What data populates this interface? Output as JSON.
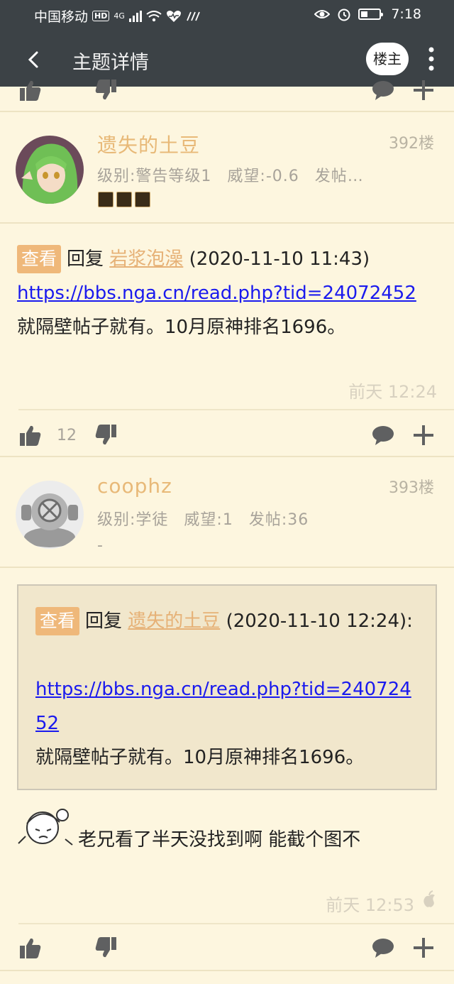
{
  "statusbar": {
    "carrier": "中国移动",
    "hd": "HD",
    "network": "4G",
    "time": "7:18"
  },
  "appbar": {
    "title": "主题详情",
    "louzhu_label": "楼主"
  },
  "posts": [
    {
      "username": "遗失的土豆",
      "floor": "392楼",
      "level": "级别:警告等级1",
      "prestige": "威望:-0.6",
      "posts": "发帖…",
      "reply_tag": "查看",
      "reply_word": "回复",
      "reply_to": "岩浆泡澡",
      "reply_time": "(2020-11-10 11:43)",
      "url": "https://bbs.nga.cn/read.php?tid=24072452",
      "text": "就隔壁帖子就有。10月原神排名1696。",
      "time": "前天 12:24",
      "like_count": "12"
    },
    {
      "username": "coophz",
      "floor": "393楼",
      "level": "级别:学徒",
      "prestige": "威望:1",
      "posts": "发帖:36",
      "signature": "-",
      "quote": {
        "tag": "查看",
        "reply_word": "回复",
        "reply_to": "遗失的土豆",
        "reply_time": "(2020-11-10 12:24):",
        "url_line1": "https://bbs.nga.cn/read.php?tid=240724",
        "url_line2": "52",
        "text": "就隔壁帖子就有。10月原神排名1696。"
      },
      "text": "老兄看了半天没找到啊 能截个图不",
      "time": "前天 12:53"
    }
  ],
  "colors": {
    "bar": "#3c4246",
    "background": "#fdf6df",
    "name": "#e8b978",
    "link": "#1a1aee",
    "tag": "#efb87a"
  }
}
